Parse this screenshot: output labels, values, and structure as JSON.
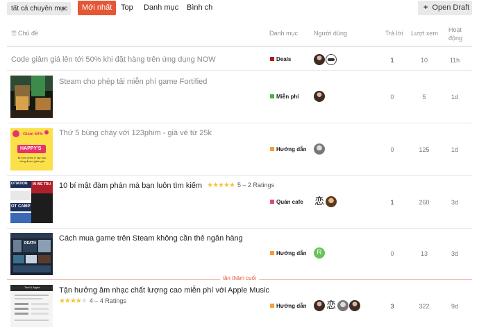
{
  "nav": {
    "category_dropdown": "tất cả chuyên mục",
    "tabs": [
      {
        "label": "Mới nhất",
        "active": true
      },
      {
        "label": "Top",
        "active": false
      },
      {
        "label": "Danh mục",
        "active": false
      },
      {
        "label": "Bình ch",
        "active": false
      }
    ],
    "open_draft": "Open Draft"
  },
  "header": {
    "topic": "Chủ đề",
    "category": "Danh mục",
    "users": "Người dùng",
    "replies": "Trả lời",
    "views": "Lượt xem",
    "activity": "Hoạt động"
  },
  "last_visit_label": "lần thăm cuối",
  "colors": {
    "accent": "#e45735",
    "deals": "#b3181d",
    "free": "#3ab54a",
    "guide": "#f39e38",
    "cafe": "#e0458b"
  },
  "topics": [
    {
      "title": "Code giảm giá lên tới 50% khi đặt hàng trên ứng dụng NOW",
      "category": "Deals",
      "replies": "1",
      "views": "10",
      "activity": "11h"
    },
    {
      "title": "Steam cho phép tải miễn phí game Fortified",
      "category": "Miễn phí",
      "replies": "0",
      "views": "5",
      "activity": "1d"
    },
    {
      "title": "Thứ 5 bùng cháy với 123phim - giá vé từ 25k",
      "category": "Hướng dẫn",
      "replies": "0",
      "views": "125",
      "activity": "1d",
      "thumb_text": {
        "top": "Giảm 50%",
        "main": "HAPPY'S",
        "sub": "Đi xem phim ở rạp nào cũng được giảm giá"
      }
    },
    {
      "title": "10 bí mật đàm phán mà bạn luôn tìm kiếm",
      "rating": 5,
      "rating_text": "5 – 2 Ratings",
      "category": "Quán cafe",
      "replies": "1",
      "views": "260",
      "activity": "3d",
      "thumb_text": {
        "a": "OTIATION",
        "b": "IN WE TRU",
        "c": "OT CAMP"
      }
    },
    {
      "title": "Cách mua game trên Steam không cần thẻ ngân hàng",
      "category": "Hướng dẫn",
      "replies": "0",
      "views": "13",
      "activity": "3d",
      "thumb_text": {
        "a": "DEATH"
      }
    },
    {
      "title": "Tận hưởng âm nhạc chất lượng cao miễn phí với Apple Music",
      "rating": 4,
      "rating_text": "4 – 4 Ratings",
      "category": "Hướng dẫn",
      "replies": "3",
      "views": "322",
      "activity": "9d",
      "thumb_text": {
        "a": "Tout & Apple"
      }
    }
  ],
  "avatar_letter": "R",
  "kanji": "恋"
}
